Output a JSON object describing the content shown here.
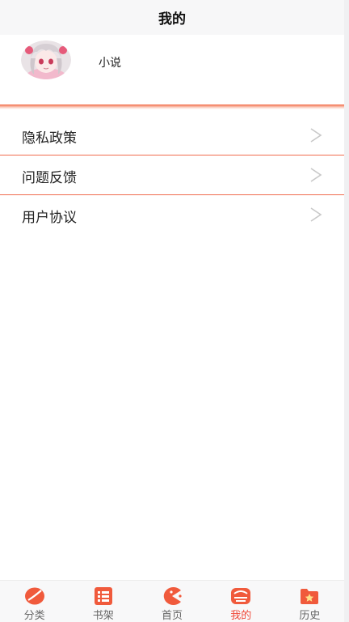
{
  "header": {
    "title": "我的"
  },
  "profile": {
    "name": "小说",
    "avatar_icon": "anime-girl-avatar"
  },
  "menu": {
    "items": [
      {
        "label": "隐私政策",
        "icon": "chevron-right-icon"
      },
      {
        "label": "问题反馈",
        "icon": "chevron-right-icon"
      },
      {
        "label": "用户协议",
        "icon": "chevron-right-icon"
      }
    ]
  },
  "tabbar": {
    "active": "我的",
    "items": [
      {
        "label": "分类",
        "icon": "category-icon"
      },
      {
        "label": "书架",
        "icon": "bookshelf-icon"
      },
      {
        "label": "首页",
        "icon": "home-icon"
      },
      {
        "label": "我的",
        "icon": "mine-icon"
      },
      {
        "label": "历史",
        "icon": "history-icon"
      }
    ]
  },
  "colors": {
    "accent": "#f05a3c",
    "divider": "#f06d4f",
    "header_bg": "#f7f7f8",
    "tab_text": "#666666"
  }
}
